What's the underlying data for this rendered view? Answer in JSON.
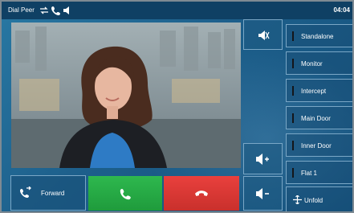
{
  "statusbar": {
    "title": "Dial Peer",
    "icons": [
      "call-transfer-icon",
      "phone-icon",
      "speaker-icon"
    ],
    "time": "04:04"
  },
  "video": {
    "description_icon": "video-stream"
  },
  "controls": {
    "mute_icon": "speaker-mute-icon",
    "volume_up_icon": "volume-up-icon",
    "volume_down_icon": "volume-down-icon",
    "forward_label": "Forward",
    "answer_icon": "phone-answer-icon",
    "reject_icon": "phone-hangup-icon"
  },
  "sidebar": {
    "items": [
      {
        "label": "Standalone"
      },
      {
        "label": "Monitor"
      },
      {
        "label": "Intercept"
      },
      {
        "label": "Main Door"
      },
      {
        "label": "Inner Door"
      },
      {
        "label": "Flat 1"
      }
    ],
    "unfold_label": "Unfold"
  },
  "colors": {
    "answer": "#23a843",
    "reject": "#d9342f",
    "background": "#1c5b82"
  }
}
